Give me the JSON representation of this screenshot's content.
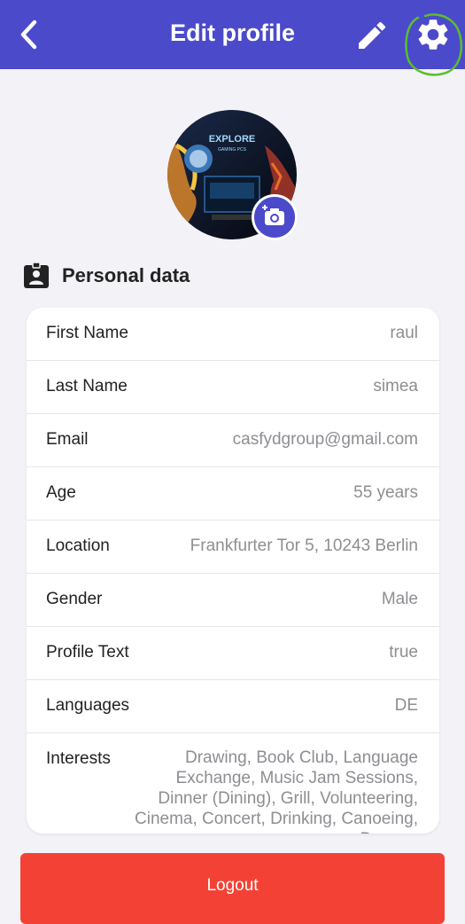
{
  "header": {
    "title": "Edit profile"
  },
  "section": {
    "title": "Personal data"
  },
  "fields": [
    {
      "label": "First Name",
      "value": "raul"
    },
    {
      "label": "Last Name",
      "value": "simea"
    },
    {
      "label": "Email",
      "value": "casfydgroup@gmail.com"
    },
    {
      "label": "Age",
      "value": "55 years"
    },
    {
      "label": "Location",
      "value": "Frankfurter Tor 5, 10243 Berlin"
    },
    {
      "label": "Gender",
      "value": "Male"
    },
    {
      "label": "Profile Text",
      "value": "true"
    },
    {
      "label": "Languages",
      "value": "DE"
    },
    {
      "label": "Interests",
      "value": "Drawing, Book Club, Language Exchange, Music Jam Sessions, Dinner (Dining), Grill, Volunteering, Cinema, Concert, Drinking, Canoeing, Bungee"
    }
  ],
  "avatar": {
    "caption": "EXPLORE",
    "subcaption": "GAMING PCS"
  },
  "footer": {
    "logout_label": "Logout"
  },
  "colors": {
    "primary": "#4b4acb",
    "danger": "#f34235",
    "annotation": "#5bbf2a"
  },
  "icons": [
    "back-arrow-icon",
    "pencil-icon",
    "gear-icon",
    "camera-add-icon",
    "id-badge-icon"
  ]
}
